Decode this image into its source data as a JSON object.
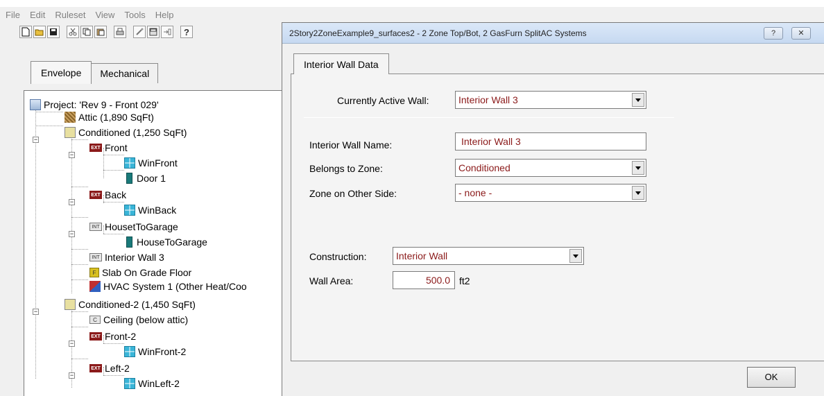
{
  "menubar": {
    "items": [
      "File",
      "Edit",
      "Ruleset",
      "View",
      "Tools",
      "Help"
    ]
  },
  "toolbar": {
    "icons": [
      "new-file-icon",
      "open-folder-icon",
      "save-icon",
      "cut-icon",
      "copy-icon",
      "paste-icon",
      "print-icon",
      "wizard-icon",
      "calculator-icon",
      "export-icon",
      "help-icon"
    ]
  },
  "left_tabs": {
    "envelope": "Envelope",
    "mechanical": "Mechanical"
  },
  "tree": {
    "project": "Project:  'Rev 9 - Front 029'",
    "attic": "Attic (1,890 SqFt)",
    "conditioned": "Conditioned (1,250 SqFt)",
    "front": "Front",
    "win_front": "WinFront",
    "door_1": "Door 1",
    "back": "Back",
    "win_back": "WinBack",
    "house_to_garage_wall": "HousetToGarage",
    "house_to_garage_door": "HouseToGarage",
    "interior_wall_3": "Interior Wall 3",
    "slab": "Slab On Grade Floor",
    "hvac": "HVAC System 1 (Other Heat/Coo",
    "conditioned_2": "Conditioned-2 (1,450 SqFt)",
    "ceiling": "Ceiling (below attic)",
    "front_2": "Front-2",
    "win_front_2": "WinFront-2",
    "left_2": "Left-2",
    "win_left_2": "WinLeft-2",
    "icon_text": {
      "ext": "EXT",
      "int": "INT",
      "slab": "F",
      "ceiling": "C"
    }
  },
  "dialog": {
    "title": "2Story2ZoneExample9_surfaces2 - 2 Zone Top/Bot, 2 GasFurn SplitAC Systems",
    "help_btn": "?",
    "close_btn": "✕",
    "tab_label": "Interior Wall Data",
    "active_wall_label": "Currently Active Wall:",
    "active_wall_value": "Interior Wall 3",
    "name_label": "Interior Wall Name:",
    "name_value": "Interior Wall 3",
    "zone_label": "Belongs to Zone:",
    "zone_value": "Conditioned",
    "other_side_label": "Zone on Other Side:",
    "other_side_value": "- none -",
    "construction_label": "Construction:",
    "construction_value": "Interior Wall",
    "area_label": "Wall Area:",
    "area_value": "500.0",
    "area_unit": "ft2",
    "ok_label": "OK"
  }
}
